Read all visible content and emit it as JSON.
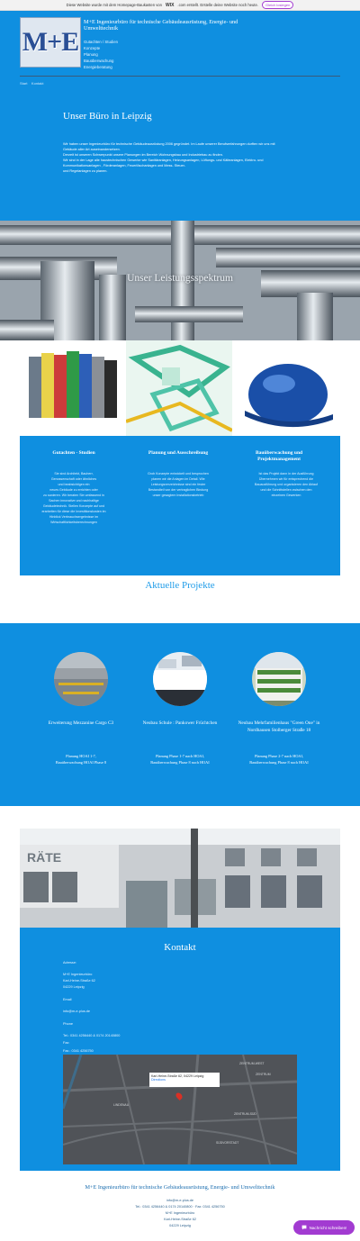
{
  "wix_bar": {
    "text_before": "Diese Website wurde mit dem Homepage-Baukasten von",
    "brand": "WIX",
    "text_after": ".com erstellt. Erstelle deine Website noch heute.",
    "button": "Gleich loslegen"
  },
  "header": {
    "logo_text": "M+E",
    "company": "M+E Ingenieurbüro für technische Gebäudeausrüstung, Energie- und Umwelttechnik",
    "services": [
      "Gutachten / Studien",
      "Konzepte",
      "Planung",
      "Bauüberwachung",
      "Energieberatung"
    ],
    "breadcrumb": [
      "Start",
      "Kontakt"
    ]
  },
  "about": {
    "title": "Unser Büro in Leipzig",
    "lines": [
      "Wir haben unser Ingenieurbüro für technische Gebäudeausrüstung  2006 gegründet. Im Laufe unserer Berufserfahrungen  durften wir uns mit",
      "Gebäude aller Art auseinandersetzen.",
      "Derzeit ist unseren Schwerpunkt unsere Planungen im Bereich Wohnungsbau und Industriebau zu finden.",
      "Wir sind in der Lage alle haustechnischen Gewerke wie Sanitäranlagen, Heizungsanlagen, Lüftungs- und Kälteanlagen, Elektro- und",
      "Kommunikationsanlagen , Förderanlagen, Feuerlöschanlagen und Mess- Steuer-",
      "und Regelanlagen zu planen."
    ]
  },
  "spectrum": {
    "title": "Unser Leistungsspektrum"
  },
  "columns": [
    {
      "title": "Gutachten - Studien",
      "text": [
        "Sie sind Architekt, Bauherr,",
        "Genossenschaft oder ähnliches",
        "und beabsichtigen ein",
        "neues Gebäude zu errichten oder",
        "zu sanieren. Wir beraten Sie umfassend in",
        "Sachen innovative und nachhaltige",
        "Gebäudetechnik. Stellen Konzepte auf und",
        "erarbeiten für diese die Investitionskosten im",
        "Hinblick Verbrauchsergebnisse im",
        "Wirtschaftlichkeitsberechnungen"
      ]
    },
    {
      "title": "Planung und Ausschreibung",
      "text": [
        "Grob Konzepte entwickelt und besprochen",
        "planen wir die Anlagen im Detail. Wie",
        "Leistungsverzeichnisse sind ein fester",
        "Bestandteil von der vertraglichen Bindung",
        "unser gesagtem Installationsbetrieb"
      ]
    },
    {
      "title": "Bauüberwachung und Projektmanagement",
      "text": [
        "Ist das Projekt dann in der Ausführung",
        "Übernehmen wir für entsprechend die",
        "Bauausführung und organisieren den Ablauf",
        "und die Schnittstellen zwischen den",
        "einzelnen Gewerken"
      ]
    }
  ],
  "projects_title": "Aktuelle Projekte",
  "projects": [
    {
      "title": "Erweiterung Mezzanine Cargo C3",
      "lines": [
        "Planung  HOAI 1-7,",
        "Bauüberwachung  HOAI Phase 8"
      ]
    },
    {
      "title": "Neubau Schule : Pankower Früchtchen",
      "lines": [
        "Planung Phase 1-7 nach HOAI,",
        "Bauüberwachung Phase 8 nach HOAI"
      ]
    },
    {
      "title": "Neubau Mehrfamilienhaus \"Green One\" in Nordhausen Stolberger Straße 18",
      "lines": [
        "Planung Phase 2-7 nach HOAI,",
        "Bauüberwachung Phase 8 nach HOAI"
      ]
    }
  ],
  "contact": {
    "title": "Kontakt",
    "address_label": "Adresse:",
    "address": [
      "M+E Ingenieurbüro",
      "Karl-Heine-Straße 62",
      "04229 Leipzig"
    ],
    "email_label": "Email",
    "email": "info@m-e-plus.de",
    "phone_label": "Phone",
    "phone": "Tel.: 0341 4256440 & 0174 20140800",
    "fax_label": "Fax:",
    "fax": "Fax.: 0341 4256750",
    "map_popup": "Karl-Heine-Straße 62, 04229 Leipzig",
    "map_link": "Directions",
    "map_labels": [
      "ZENTRUM-WEST",
      "ZENTRUM",
      "ZENTRUM-SÜD",
      "SÜDVORSTADT",
      "LINDENAU"
    ]
  },
  "footer": {
    "title": "M+E Ingenieurbüro für technische Gebäudeausrüstung, Energie- und Umwelttechnik",
    "lines": [
      "info@m-e-plus.de",
      "Tel.: 0341 4256440 & 0174 20140800 · Fax: 0341 4256750",
      "M+E Ingenieurbüro",
      "Karl-Heine-Straße 62",
      "04229 Leipzig"
    ]
  },
  "chat": {
    "label": "Nachricht schreiben!",
    "icon": "chat-icon"
  },
  "colors": {
    "primary": "#0f8fe0",
    "title_blue": "#1d9be8",
    "chat": "#a23bd1"
  }
}
